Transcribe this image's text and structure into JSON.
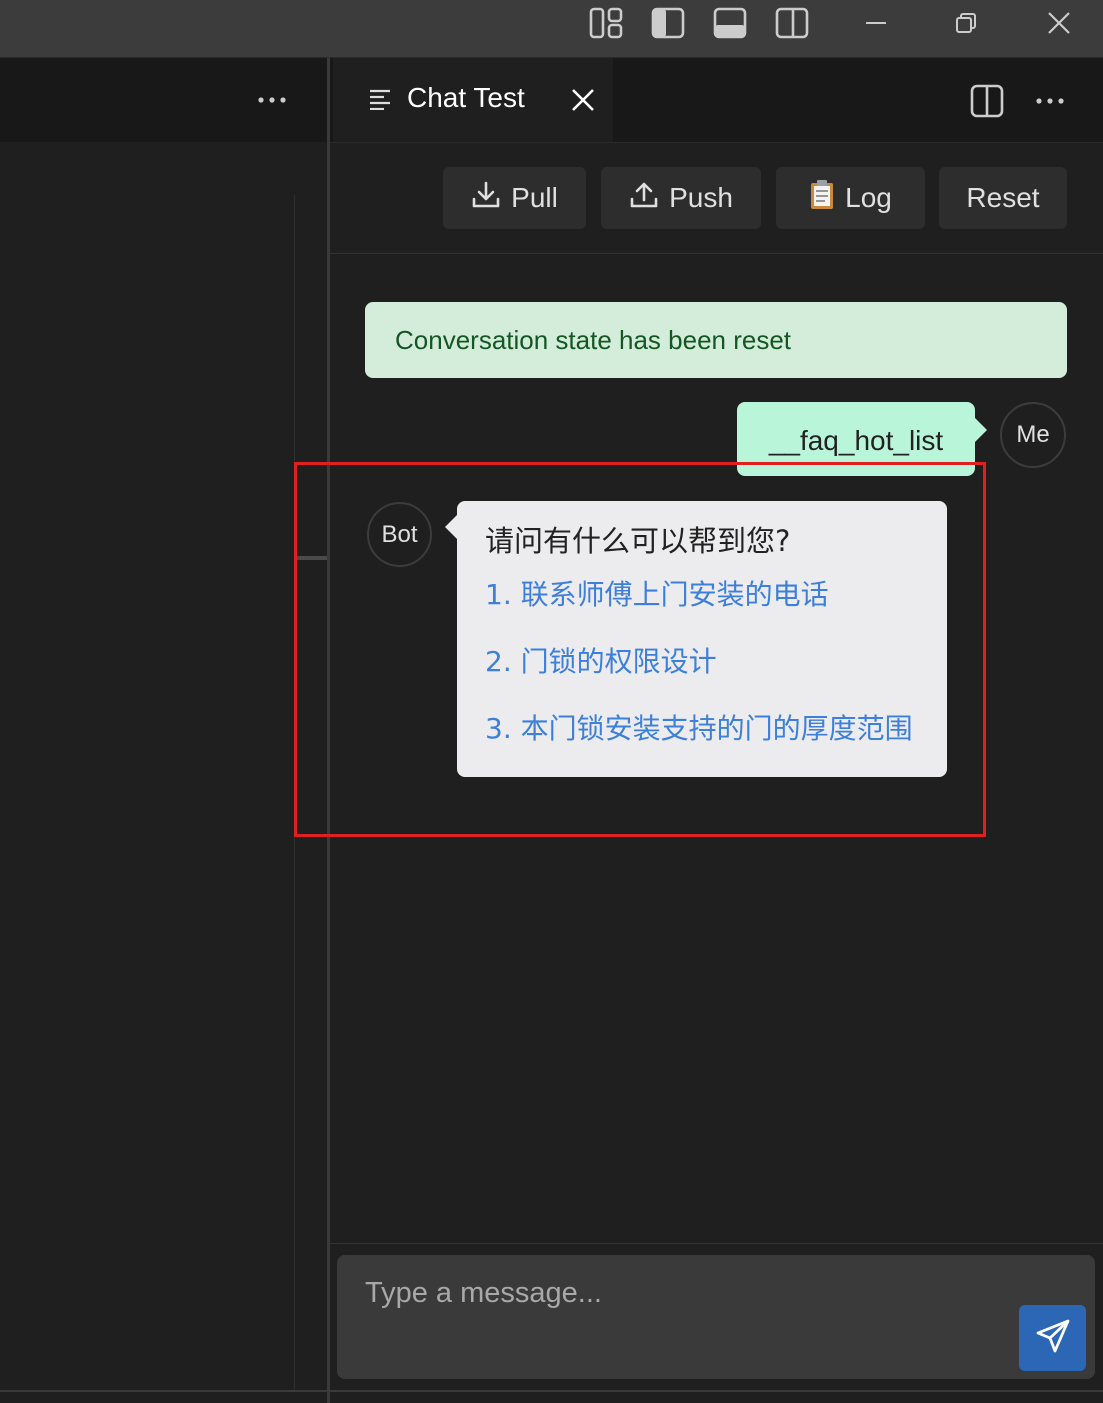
{
  "window": {
    "controls": [
      "layout-icon",
      "toggle-primary-sidebar-icon",
      "toggle-panel-icon",
      "toggle-secondary-sidebar-icon",
      "minimize-icon",
      "restore-icon",
      "close-icon"
    ]
  },
  "editor": {
    "tab": {
      "title": "Chat Test",
      "icon": "list-icon"
    }
  },
  "toolbar": {
    "pull_label": "Pull",
    "push_label": "Push",
    "log_label": "Log",
    "log_emoji": "📋",
    "reset_label": "Reset"
  },
  "chat": {
    "notice": "Conversation state has been reset",
    "user_message": "__faq_hot_list",
    "user_avatar": "Me",
    "bot_avatar": "Bot",
    "bot_question": "请问有什么可以帮到您?",
    "bot_options": [
      "1. 联系师傅上门安装的电话",
      "2. 门锁的权限设计",
      "3. 本门锁安装支持的门的厚度范围"
    ]
  },
  "input": {
    "placeholder": "Type a message..."
  },
  "colors": {
    "notice_bg": "#d4edda",
    "notice_text": "#155724",
    "user_bubble": "#b9f5d8",
    "bot_bubble": "#ececee",
    "link": "#3d7fd9",
    "send_button": "#2b67b5",
    "highlight": "#e02020"
  }
}
